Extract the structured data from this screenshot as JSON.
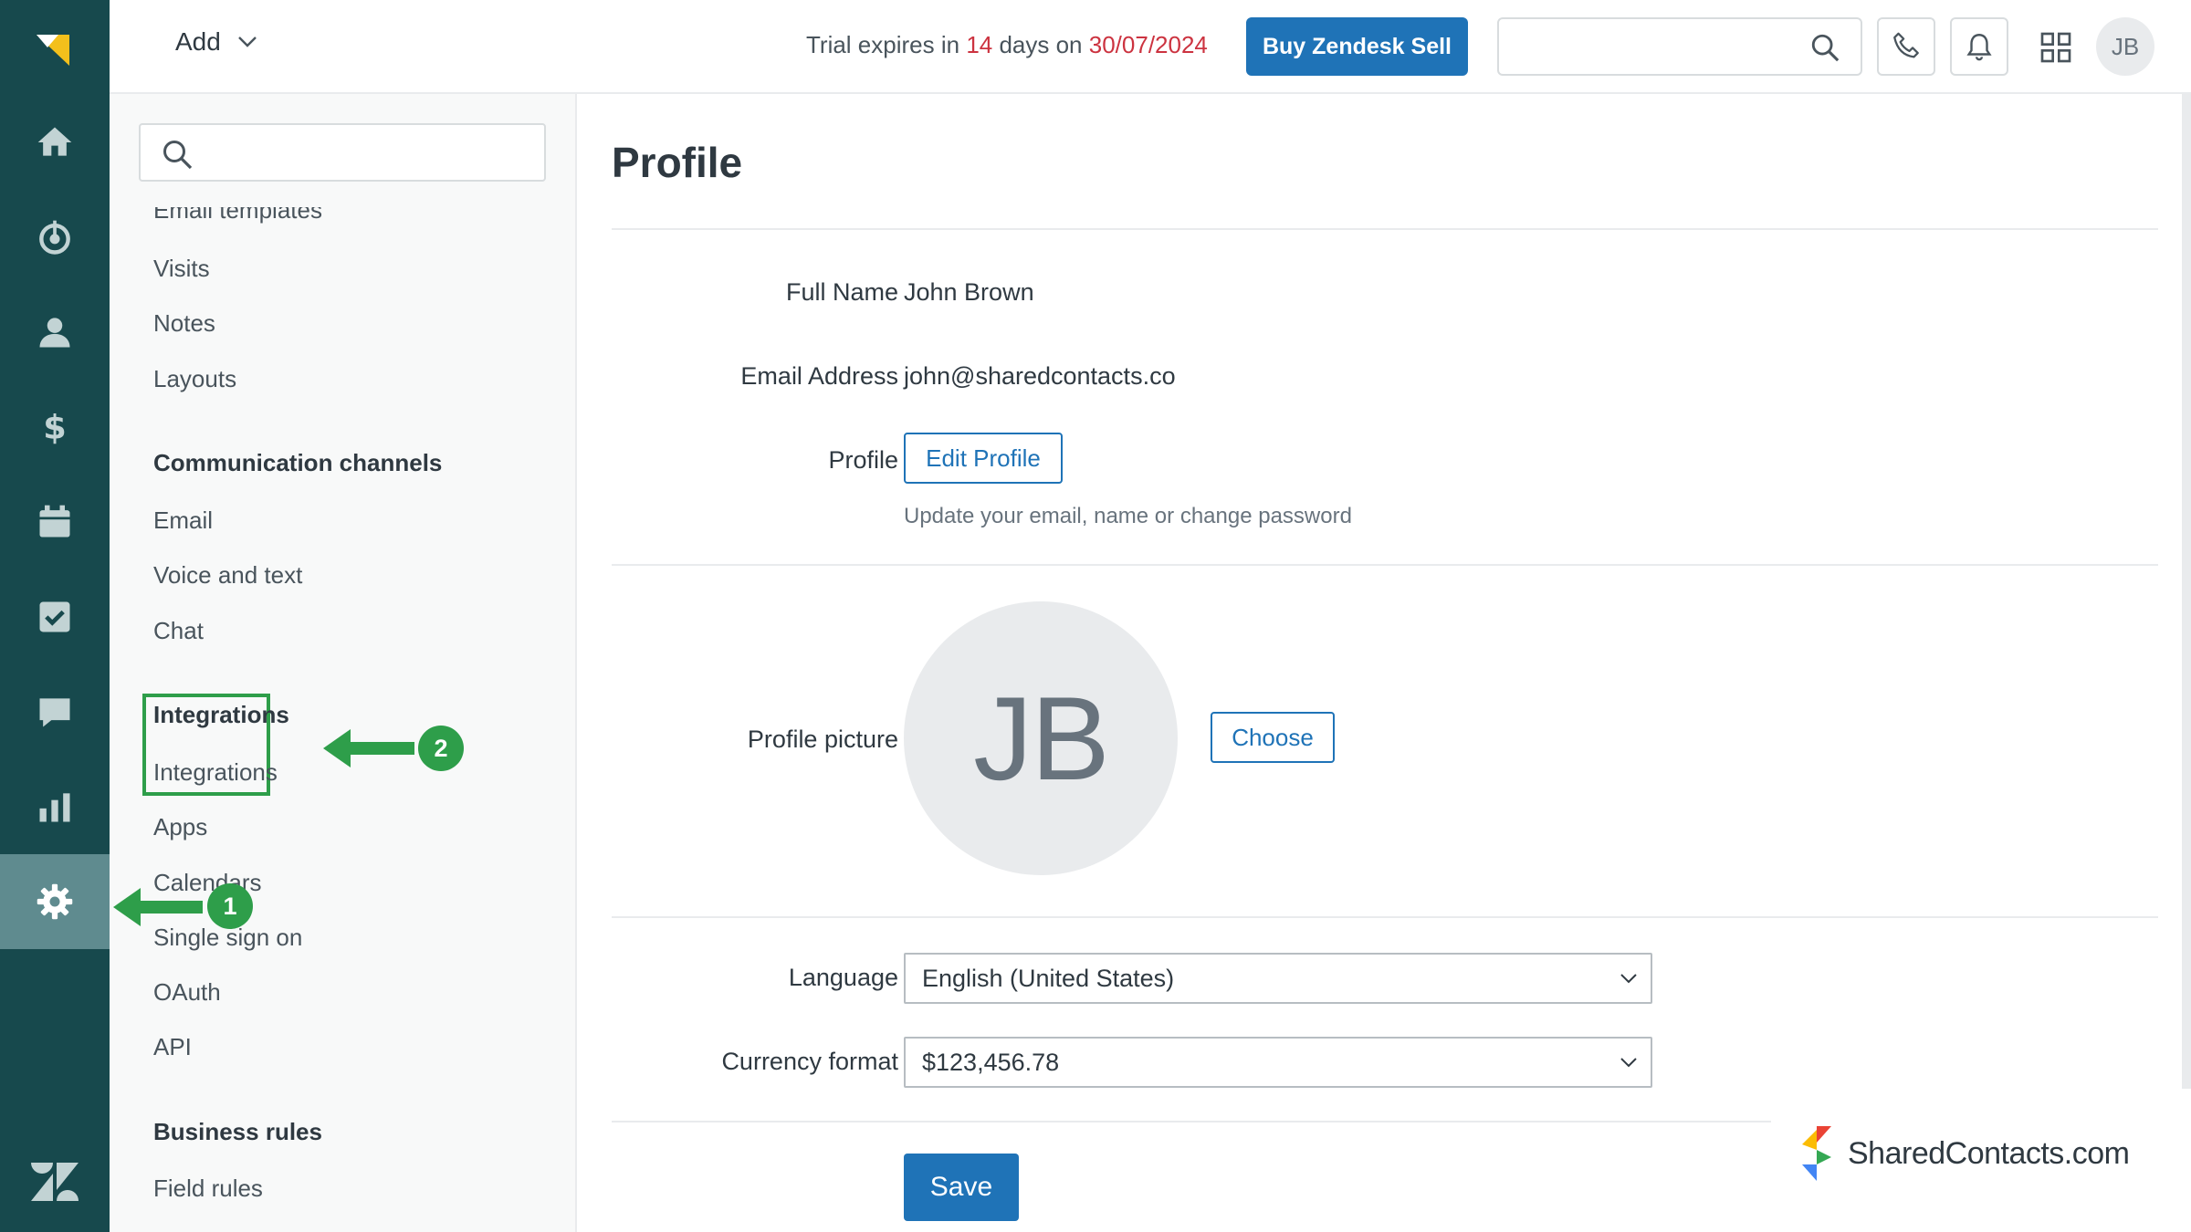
{
  "header": {
    "add_label": "Add",
    "trial_prefix": "Trial expires in ",
    "trial_days": "14",
    "trial_middle": " days on ",
    "trial_date": "30/07/2024",
    "buy_label": "Buy Zendesk Sell",
    "search_placeholder": "",
    "avatar_initials": "JB"
  },
  "settings_nav": {
    "search_placeholder": "",
    "partial_item": "Email templates",
    "items_a": [
      "Visits",
      "Notes",
      "Layouts"
    ],
    "section_comm": "Communication channels",
    "items_comm": [
      "Email",
      "Voice and text",
      "Chat"
    ],
    "section_integrations": "Integrations",
    "items_integrations": [
      "Integrations",
      "Apps",
      "Calendars",
      "Single sign on",
      "OAuth",
      "API"
    ],
    "section_business": "Business rules",
    "items_business": [
      "Field rules"
    ]
  },
  "annotations": {
    "badge_1": "1",
    "badge_2": "2"
  },
  "profile": {
    "title": "Profile",
    "full_name_label": "Full Name",
    "full_name": "John Brown",
    "email_label": "Email Address",
    "email": "john@sharedcontacts.co",
    "profile_label": "Profile",
    "edit_profile": "Edit Profile",
    "edit_hint": "Update your email, name or change password",
    "picture_label": "Profile picture",
    "avatar_initials": "JB",
    "choose": "Choose",
    "language_label": "Language",
    "language_value": "English (United States)",
    "currency_label": "Currency format",
    "currency_value": "$123,456.78",
    "save": "Save"
  },
  "watermark": {
    "text": "SharedContacts.com"
  },
  "colors": {
    "rail": "#17494d",
    "rail_active": "#5f8b8f",
    "primary": "#1f73b7",
    "annotation": "#2e9e4a",
    "alert_red": "#cc3340"
  }
}
